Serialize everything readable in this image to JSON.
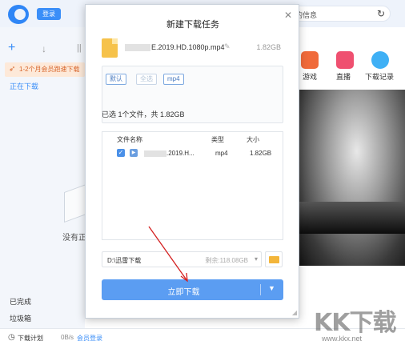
{
  "app": {
    "login_label": "登录",
    "search_placeholder": "的信息",
    "promo_text": "1-2个月会员跑速下载",
    "downloading_label": "正在下载",
    "empty_text": "没有正",
    "completed_label": "已完成",
    "trash_label": "垃圾箱",
    "footer": {
      "plan_label": "下载计划",
      "speed": "0B/s",
      "vip_login": "会员登录"
    },
    "tiles": [
      {
        "label": "游戏",
        "icon": "gamepad-icon",
        "color": "#f06a3a"
      },
      {
        "label": "直播",
        "icon": "live-tv-icon",
        "color": "#ef5070"
      },
      {
        "label": "下载记录",
        "icon": "cloud-icon",
        "color": "#3fb0f5"
      }
    ]
  },
  "dialog": {
    "title": "新建下载任务",
    "file_name_prefix": "",
    "file_name_suffix": "E.2019.HD.1080p.mp4",
    "file_size": "1.82GB",
    "tags": [
      "默认",
      "全选",
      "mp4"
    ],
    "selected_summary": "已选 1个文件，共 1.82GB",
    "table": {
      "headers": {
        "name": "文件名称",
        "type": "类型",
        "size": "大小"
      },
      "rows": [
        {
          "name_prefix": "",
          "name_suffix": ".2019.H...",
          "type": "mp4",
          "size": "1.82GB",
          "checked": true
        }
      ]
    },
    "path": {
      "value": "D:\\迅雷下载",
      "free_space": "剩余:118.08GB"
    },
    "download_label": "立即下载"
  },
  "watermark": {
    "text": "KK下载",
    "url": "www.kkx.net"
  }
}
